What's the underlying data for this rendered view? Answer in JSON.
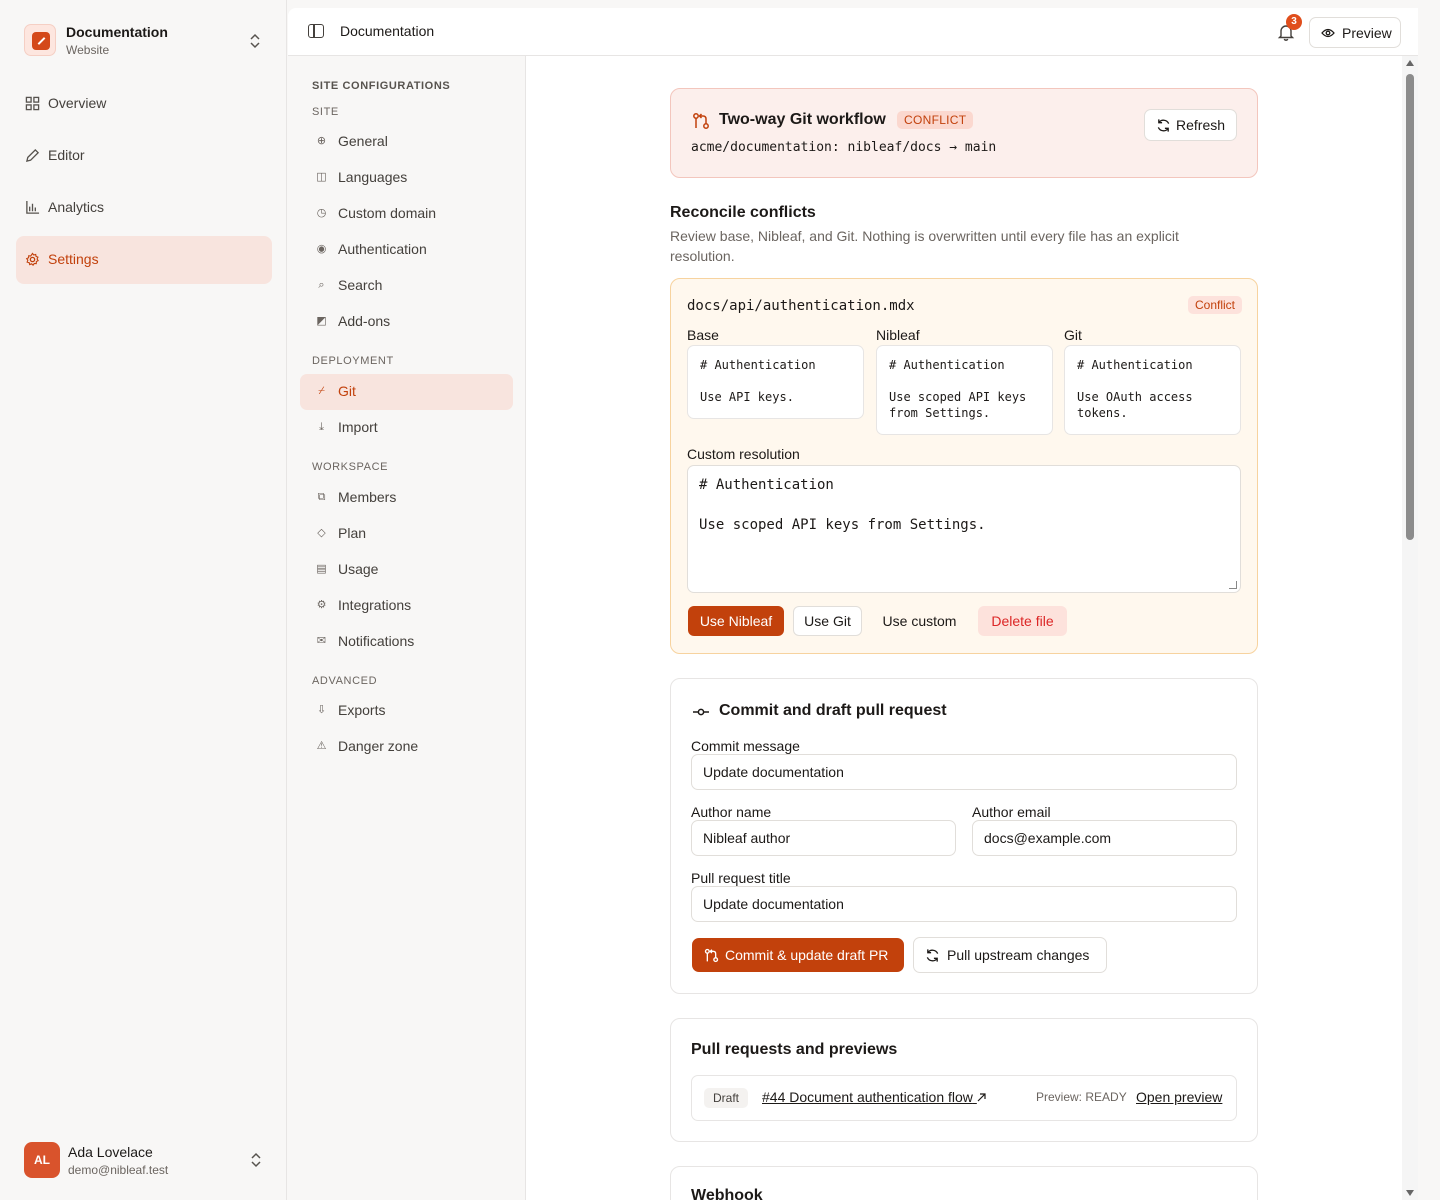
{
  "workspace": {
    "name": "Documentation",
    "subtitle": "Website"
  },
  "nav": [
    {
      "label": "Overview",
      "icon": "layout-grid-icon"
    },
    {
      "label": "Editor",
      "icon": "pencil-icon"
    },
    {
      "label": "Analytics",
      "icon": "bar-chart-icon"
    },
    {
      "label": "Settings",
      "icon": "gear-icon",
      "active": true
    }
  ],
  "user": {
    "initials": "AL",
    "name": "Ada Lovelace",
    "email": "demo@nibleaf.test"
  },
  "topbar": {
    "breadcrumb": "Documentation",
    "notification_count": "3",
    "preview_label": "Preview"
  },
  "subnav": {
    "heading": "SITE CONFIGURATIONS",
    "sections": [
      {
        "title": "SITE",
        "items": [
          "General",
          "Languages",
          "Custom domain",
          "Authentication",
          "Search",
          "Add-ons"
        ]
      },
      {
        "title": "DEPLOYMENT",
        "items": [
          "Git",
          "Import"
        ]
      },
      {
        "title": "WORKSPACE",
        "items": [
          "Members",
          "Plan",
          "Usage",
          "Integrations",
          "Notifications"
        ]
      },
      {
        "title": "ADVANCED",
        "items": [
          "Exports",
          "Danger zone"
        ]
      }
    ],
    "active_item": "Git"
  },
  "git_banner": {
    "title": "Two-way Git workflow",
    "status": "CONFLICT",
    "repo": "acme/documentation: nibleaf/docs → main",
    "refresh_label": "Refresh"
  },
  "reconcile": {
    "title": "Reconcile conflicts",
    "description": "Review base, Nibleaf, and Git. Nothing is overwritten until every file has an explicit resolution.",
    "file": {
      "path": "docs/api/authentication.mdx",
      "status": "Conflict",
      "base": {
        "label": "Base",
        "content": "# Authentication\n\nUse API keys."
      },
      "nibleaf": {
        "label": "Nibleaf",
        "content": "# Authentication\n\nUse scoped API keys\nfrom Settings."
      },
      "git": {
        "label": "Git",
        "content": "# Authentication\n\nUse OAuth access\ntokens."
      },
      "custom_label": "Custom resolution",
      "custom_value": "# Authentication\n\nUse scoped API keys from Settings.",
      "actions": {
        "use_nibleaf": "Use Nibleaf",
        "use_git": "Use Git",
        "use_custom": "Use custom",
        "delete": "Delete file"
      }
    }
  },
  "commit": {
    "title": "Commit and draft pull request",
    "commit_message_label": "Commit message",
    "commit_message": "Update documentation",
    "author_name_label": "Author name",
    "author_name": "Nibleaf author",
    "author_email_label": "Author email",
    "author_email": "docs@example.com",
    "pr_title_label": "Pull request title",
    "pr_title": "Update documentation",
    "primary_action": "Commit & update draft PR",
    "secondary_action": "Pull upstream changes"
  },
  "pull_requests": {
    "title": "Pull requests and previews",
    "items": [
      {
        "state": "Draft",
        "title": "#44 Document authentication flow",
        "preview_status": "Preview: READY",
        "open_label": "Open preview"
      }
    ]
  },
  "webhook": {
    "title": "Webhook"
  },
  "colors": {
    "accent": "#c2410c",
    "accent_bg": "#f8e4de",
    "conflict_bg": "#fcefec",
    "warning_bg": "#fff8ee",
    "primary_button": "#c2410c"
  }
}
